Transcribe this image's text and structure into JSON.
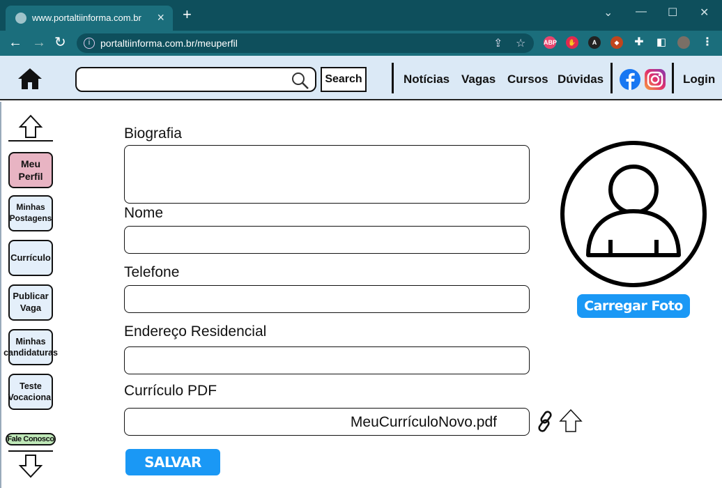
{
  "browser": {
    "tab_title": "www.portaltiinforma.com.br",
    "url": "portaltiinforma.com.br/meuperfil"
  },
  "header": {
    "search_placeholder": "",
    "search_label": "Search",
    "nav": [
      "Notícias",
      "Vagas",
      "Cursos",
      "Dúvidas"
    ],
    "login": "Login"
  },
  "sidebar": {
    "items": [
      {
        "label": "Meu Perfil",
        "active": true
      },
      {
        "label": "Minhas Postagens"
      },
      {
        "label": "Currículo"
      },
      {
        "label": "Publicar Vaga"
      },
      {
        "label": "Minhas candidaturas"
      },
      {
        "label": "Teste Vocacional"
      }
    ],
    "contact": "Fale Conosco"
  },
  "form": {
    "bio_label": "Biografia",
    "name_label": "Nome",
    "phone_label": "Telefone",
    "address_label": "Endereço Residencial",
    "cv_label": "Currículo PDF",
    "cv_file": "MeuCurrículoNovo.pdf",
    "save": "SALVAR"
  },
  "profile": {
    "upload_photo": "Carregar Foto"
  },
  "colors": {
    "accent": "#1a98f5",
    "header_bg": "#dbe9f6",
    "active_item": "#e8b4c3",
    "contact_bg": "#bfe8b8"
  }
}
